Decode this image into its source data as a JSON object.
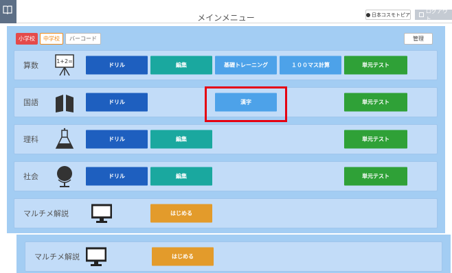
{
  "header": {
    "title": "メインメニュー",
    "school_name": "日本コスモトピア",
    "logout_label": "ログアウト"
  },
  "tabs": {
    "elementary": "小学校",
    "junior_high": "中学校",
    "barcode": "バーコード",
    "manage": "管理"
  },
  "rows": {
    "math": {
      "label": "算数",
      "icon_text": "1+2=",
      "buttons": {
        "drill": "ドリル",
        "edit": "編集",
        "basic_training": "基礎トレーニング",
        "hundred_cell": "１００マス計算",
        "unit_test": "単元テスト"
      }
    },
    "japanese": {
      "label": "国語",
      "buttons": {
        "drill": "ドリル",
        "kanji": "漢字",
        "unit_test": "単元テスト"
      }
    },
    "science": {
      "label": "理科",
      "buttons": {
        "drill": "ドリル",
        "edit": "編集",
        "unit_test": "単元テスト"
      }
    },
    "social": {
      "label": "社会",
      "buttons": {
        "drill": "ドリル",
        "edit": "編集",
        "unit_test": "単元テスト"
      }
    },
    "multime": {
      "label": "マルチメ解説",
      "start": "はじめる"
    },
    "multime2": {
      "label": "マルチメ解説",
      "start": "はじめる"
    }
  },
  "colors": {
    "panel_bg": "#a3cdf3",
    "row_bg": "#c2dcf8",
    "drill_blue": "#1e5fbf",
    "edit_teal": "#1aa89f",
    "light_blue": "#4da2e9",
    "test_green": "#2fa137",
    "start_orange": "#e39b2b",
    "highlight_red": "#e50012"
  },
  "highlight_target": "kanji-button"
}
